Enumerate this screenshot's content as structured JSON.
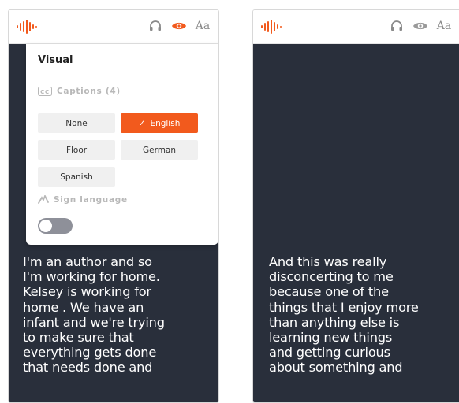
{
  "colors": {
    "accent": "#f25a1d",
    "dark_background": "#292f3b",
    "panel": "#ffffff",
    "muted": "#b8b8b8"
  },
  "left_screen": {
    "header": {
      "logo": "waveform-logo",
      "icons": [
        "headphones-icon",
        "eye-icon",
        "text-size-icon"
      ],
      "active_icon": "eye-icon",
      "text_size_label": "Aa"
    },
    "visual_panel": {
      "title": "Visual",
      "captions": {
        "label": "Captions (4)",
        "options": [
          "None",
          "English",
          "Floor",
          "German",
          "Spanish"
        ],
        "selected": "English"
      },
      "sign_language": {
        "label": "Sign language",
        "enabled": false
      }
    },
    "transcript": "I'm an author and so\nI'm working for home.\nKelsey is working for\nhome . We have an\ninfant and we're trying\nto make sure that\neverything gets done\nthat needs done and"
  },
  "right_screen": {
    "header": {
      "logo": "waveform-logo",
      "icons": [
        "headphones-icon",
        "eye-icon",
        "text-size-icon"
      ],
      "text_size_label": "Aa"
    },
    "transcript": "And this was really\ndisconcerting to me\nbecause one of the\nthings that I enjoy more\nthan anything else is\nlearning new things\nand getting curious\nabout something and"
  }
}
